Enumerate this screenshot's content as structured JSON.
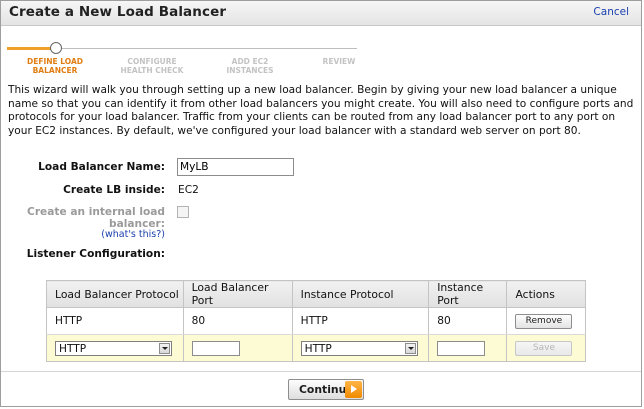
{
  "header": {
    "title": "Create a New Load Balancer",
    "cancel_label": "Cancel"
  },
  "wizard": {
    "steps": [
      {
        "label": "DEFINE LOAD BALANCER",
        "state": "active"
      },
      {
        "label": "CONFIGURE HEALTH CHECK",
        "state": "pending"
      },
      {
        "label": "ADD EC2 INSTANCES",
        "state": "pending"
      },
      {
        "label": "REVIEW",
        "state": "pending"
      }
    ]
  },
  "intro": "This wizard will walk you through setting up a new load balancer. Begin by giving your new load balancer a unique name so that you can identify it from other load balancers you might create. You will also need to configure ports and protocols for your load balancer. Traffic from your clients can be routed from any load balancer port to any port on your EC2 instances. By default, we've configured your load balancer with a standard web server on port 80.",
  "form": {
    "name_label": "Load Balancer Name:",
    "name_value": "MyLB",
    "inside_label": "Create LB inside:",
    "inside_value": "EC2",
    "internal_label": "Create an internal load balancer:",
    "internal_checked": false,
    "whats_this_label": "(what's this?)",
    "listener_label": "Listener Configuration:"
  },
  "listeners": {
    "headers": [
      "Load Balancer Protocol",
      "Load Balancer Port",
      "Instance Protocol",
      "Instance Port",
      "Actions"
    ],
    "existing": {
      "lb_protocol": "HTTP",
      "lb_port": "80",
      "instance_protocol": "HTTP",
      "instance_port": "80",
      "action_label": "Remove"
    },
    "new_row": {
      "lb_protocol_selected": "HTTP",
      "lb_port": "",
      "instance_protocol_selected": "HTTP",
      "instance_port": "",
      "action_label": "Save"
    }
  },
  "footer": {
    "continue_label": "Continue"
  },
  "colors": {
    "accent": "#f08a00",
    "new_row_bg": "#fdfbd4",
    "link": "#1a3fae"
  }
}
